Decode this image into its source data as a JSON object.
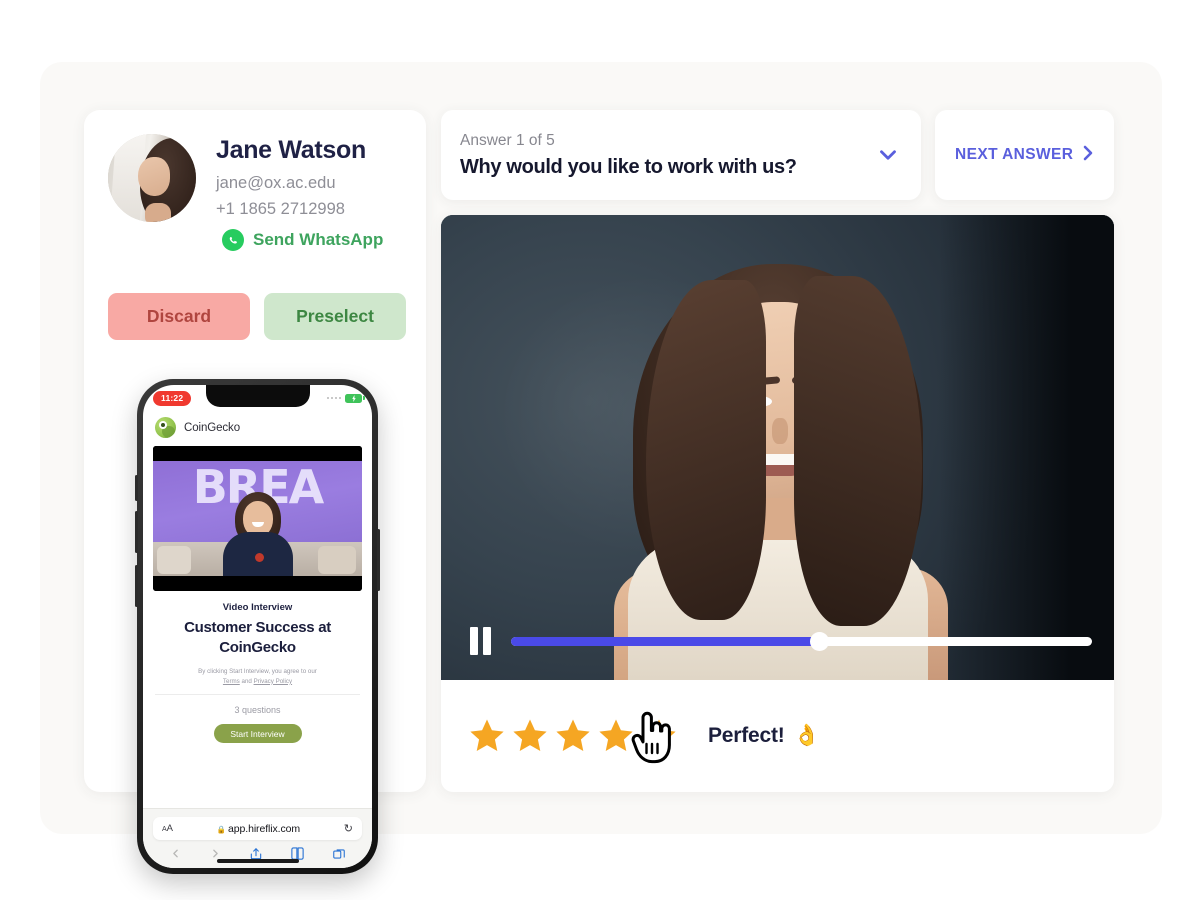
{
  "candidate": {
    "name": "Jane Watson",
    "email": "jane@ox.ac.edu",
    "phone": "+1 1865 2712998",
    "whatsapp_label": "Send WhatsApp",
    "discard_label": "Discard",
    "preselect_label": "Preselect",
    "avatar_icon": "avatar-photo"
  },
  "question": {
    "counter": "Answer 1 of 5",
    "title": "Why would you like to work with us?",
    "chevron_icon": "chevron-down-icon",
    "next_label": "NEXT ANSWER",
    "next_icon": "chevron-right-icon"
  },
  "player": {
    "pause_icon": "pause-icon",
    "progress_percent": 53,
    "fill_color": "#4a4ae8",
    "track_color": "#ffffff"
  },
  "rating": {
    "stars_total": 5,
    "stars_filled": 5,
    "star_color": "#f5a623",
    "label": "Perfect!",
    "emoji": "👌",
    "cursor_icon": "pointing-hand-cursor"
  },
  "phone": {
    "status_time": "11:22",
    "battery_icon": "battery-charging-icon",
    "signal_icon": "signal-dots-icon",
    "brand": "CoinGecko",
    "brand_icon": "coingecko-logo",
    "video_graffiti": "BREA",
    "kicker": "Video Interview",
    "title": "Customer Success at CoinGecko",
    "terms_prefix": "By clicking Start Interview, you agree to our",
    "terms_link": "Terms",
    "terms_and": "and",
    "privacy_link": "Privacy Policy",
    "question_count": "3 questions",
    "start_label": "Start Interview",
    "browser": {
      "aa_label": "A",
      "aa_small": "A",
      "lock_icon": "lock-icon",
      "url": "app.hireflix.com",
      "reload_icon": "reload-icon",
      "back_icon": "chevron-left-icon",
      "forward_icon": "chevron-right-icon",
      "share_icon": "share-icon",
      "bookmarks_icon": "book-icon",
      "tabs_icon": "tabs-icon"
    }
  },
  "colors": {
    "accent_indigo": "#5a5fdd",
    "star_orange": "#f5a623",
    "whatsapp_green": "#27cc5f",
    "discard_bg": "#f8a9a4",
    "preselect_bg": "#cfe7cc",
    "page_bg": "#faf9f7"
  }
}
